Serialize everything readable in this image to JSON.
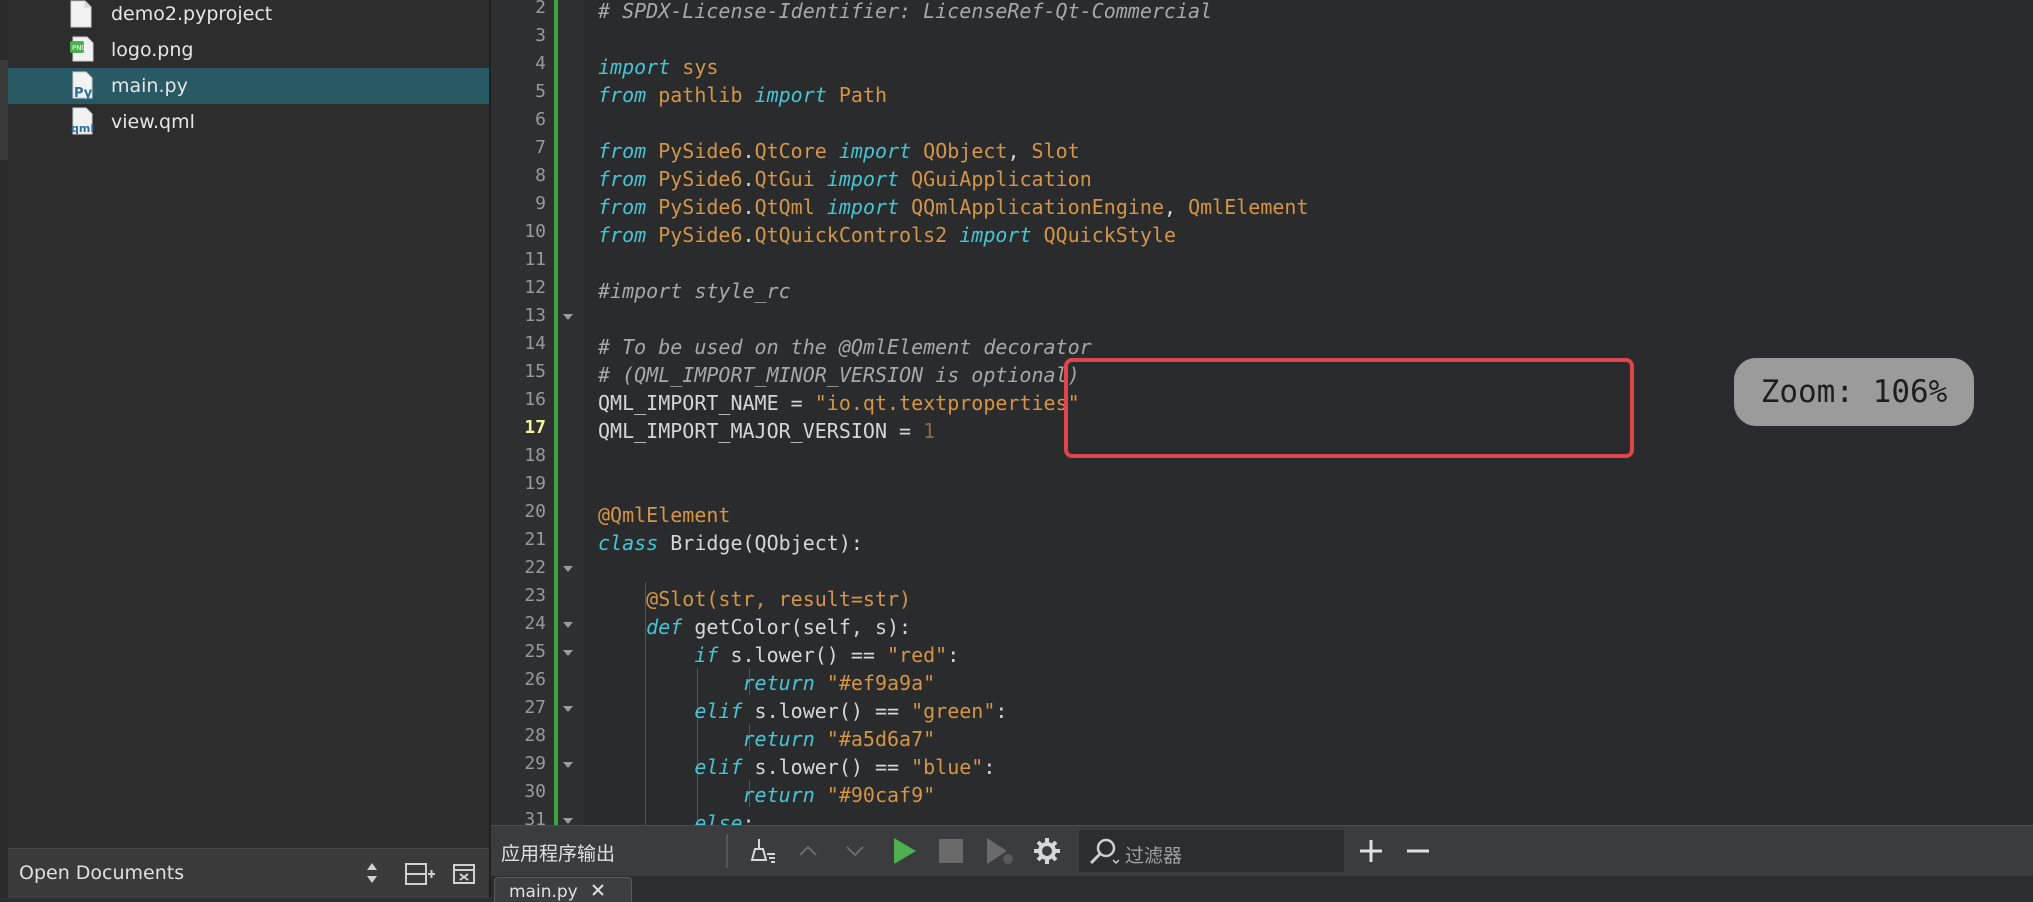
{
  "project_tree": {
    "files": [
      {
        "name": "demo2.pyproject",
        "icon": "blank-file-icon"
      },
      {
        "name": "logo.png",
        "icon": "image-file-icon"
      },
      {
        "name": "main.py",
        "icon": "python-file-icon",
        "selected": true
      },
      {
        "name": "view.qml",
        "icon": "qml-file-icon"
      }
    ]
  },
  "open_documents": {
    "label": "Open Documents"
  },
  "editor": {
    "current_line": 17,
    "line_numbers": [
      "2",
      "3",
      "4",
      "5",
      "6",
      "7",
      "8",
      "9",
      "10",
      "11",
      "12",
      "13",
      "14",
      "15",
      "16",
      "17",
      "18",
      "19",
      "20",
      "21",
      "22",
      "23",
      "24",
      "25",
      "26",
      "27",
      "28",
      "29",
      "30",
      "31"
    ],
    "zoom_label": "Zoom: 106%"
  },
  "output_pane": {
    "title": "应用程序输出",
    "filter_placeholder": "过滤器",
    "tab_label": "main.py"
  },
  "colors": {
    "keyword": "#45c6d6",
    "module": "#d69545",
    "string": "#d69545",
    "comment": "#a8a8a8",
    "selected_row": "#275a64",
    "change_bar": "#3aa640",
    "highlight_box": "#e0454a",
    "run_button": "#4caf50"
  }
}
